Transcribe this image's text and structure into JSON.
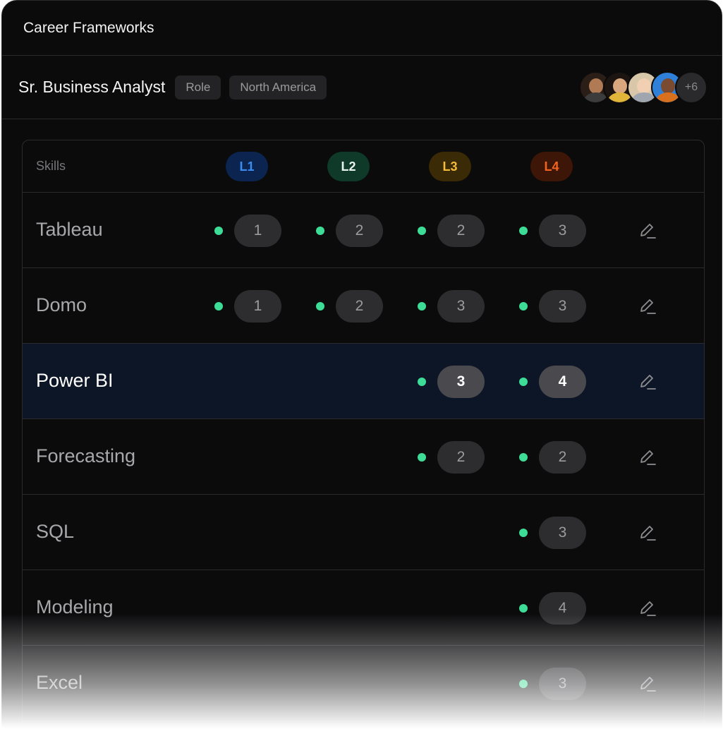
{
  "app": {
    "title": "Career Frameworks"
  },
  "role": {
    "title": "Sr. Business Analyst",
    "chips": [
      "Role",
      "North America"
    ],
    "avatars": [
      {
        "skin": "#b07a55",
        "hair": "#2a1e16",
        "shirt": "#3c3c3c"
      },
      {
        "skin": "#d9a77d",
        "hair": "#1c1410",
        "shirt": "#e1b53a"
      },
      {
        "skin": "#f1cfb3",
        "hair": "#d8c7a8",
        "shirt": "#9fa6b0"
      },
      {
        "skin": "#7a4b30",
        "hair": "#2f80d8",
        "shirt": "#d8701e"
      }
    ],
    "more_count": "+6"
  },
  "table": {
    "skills_header": "Skills",
    "levels": [
      {
        "label": "L1",
        "bg": "#0c2550",
        "fg": "#3a8cf0"
      },
      {
        "label": "L2",
        "bg": "#0f3a2a",
        "fg": "#e9f3ee"
      },
      {
        "label": "L3",
        "bg": "#3a2a06",
        "fg": "#f5bb38"
      },
      {
        "label": "L4",
        "bg": "#3d1608",
        "fg": "#f2641e"
      }
    ],
    "rows": [
      {
        "skill": "Tableau",
        "values": [
          "1",
          "2",
          "2",
          "3"
        ],
        "selected": false
      },
      {
        "skill": "Domo",
        "values": [
          "1",
          "2",
          "3",
          "3"
        ],
        "selected": false
      },
      {
        "skill": "Power BI",
        "values": [
          "",
          "",
          "3",
          "4"
        ],
        "selected": true
      },
      {
        "skill": "Forecasting",
        "values": [
          "",
          "",
          "2",
          "2"
        ],
        "selected": false
      },
      {
        "skill": "SQL",
        "values": [
          "",
          "",
          "",
          "3"
        ],
        "selected": false
      },
      {
        "skill": "Modeling",
        "values": [
          "",
          "",
          "",
          "4"
        ],
        "selected": false
      },
      {
        "skill": "Excel",
        "values": [
          "",
          "",
          "",
          "3"
        ],
        "selected": false
      }
    ]
  }
}
